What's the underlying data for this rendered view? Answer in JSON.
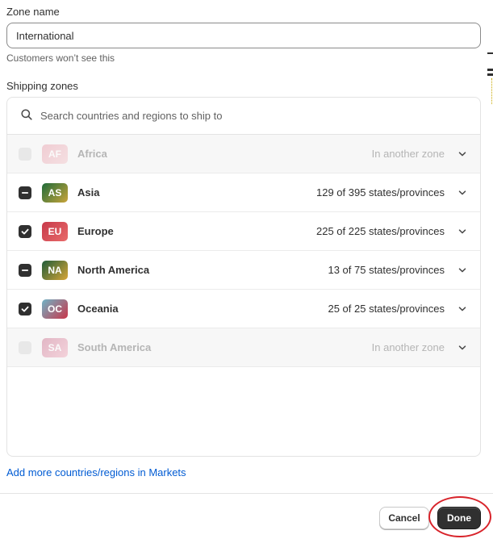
{
  "form": {
    "zone_name_label": "Zone name",
    "zone_name_value": "International",
    "zone_name_helper": "Customers won’t see this",
    "shipping_zones_label": "Shipping zones"
  },
  "search": {
    "placeholder": "Search countries and regions to ship to",
    "icon": "search-icon"
  },
  "regions": [
    {
      "code": "AF",
      "name": "Africa",
      "status": "In another zone",
      "state": "disabled",
      "badge_colors": [
        "#e89aa8",
        "#f3c4c9"
      ]
    },
    {
      "code": "AS",
      "name": "Asia",
      "status": "129 of 395 states/provinces",
      "state": "mixed",
      "badge_colors": [
        "#1e6b3a",
        "#c9a43a"
      ]
    },
    {
      "code": "EU",
      "name": "Europe",
      "status": "225 of 225 states/provinces",
      "state": "checked",
      "badge_colors": [
        "#c73a4a",
        "#e86a6a"
      ]
    },
    {
      "code": "NA",
      "name": "North America",
      "status": "13 of 75 states/provinces",
      "state": "mixed",
      "badge_colors": [
        "#1f5c3a",
        "#d8a637"
      ]
    },
    {
      "code": "OC",
      "name": "Oceania",
      "status": "25 of 25 states/provinces",
      "state": "checked",
      "badge_colors": [
        "#6fb3c6",
        "#c9364a"
      ]
    },
    {
      "code": "SA",
      "name": "South America",
      "status": "In another zone",
      "state": "disabled",
      "badge_colors": [
        "#c96a8a",
        "#f0a7b9"
      ]
    }
  ],
  "links": {
    "add_more": "Add more countries/regions in Markets"
  },
  "footer": {
    "cancel_label": "Cancel",
    "done_label": "Done"
  },
  "colors": {
    "primary_button": "#303030",
    "link": "#005bd3",
    "highlight": "#d8232a"
  }
}
